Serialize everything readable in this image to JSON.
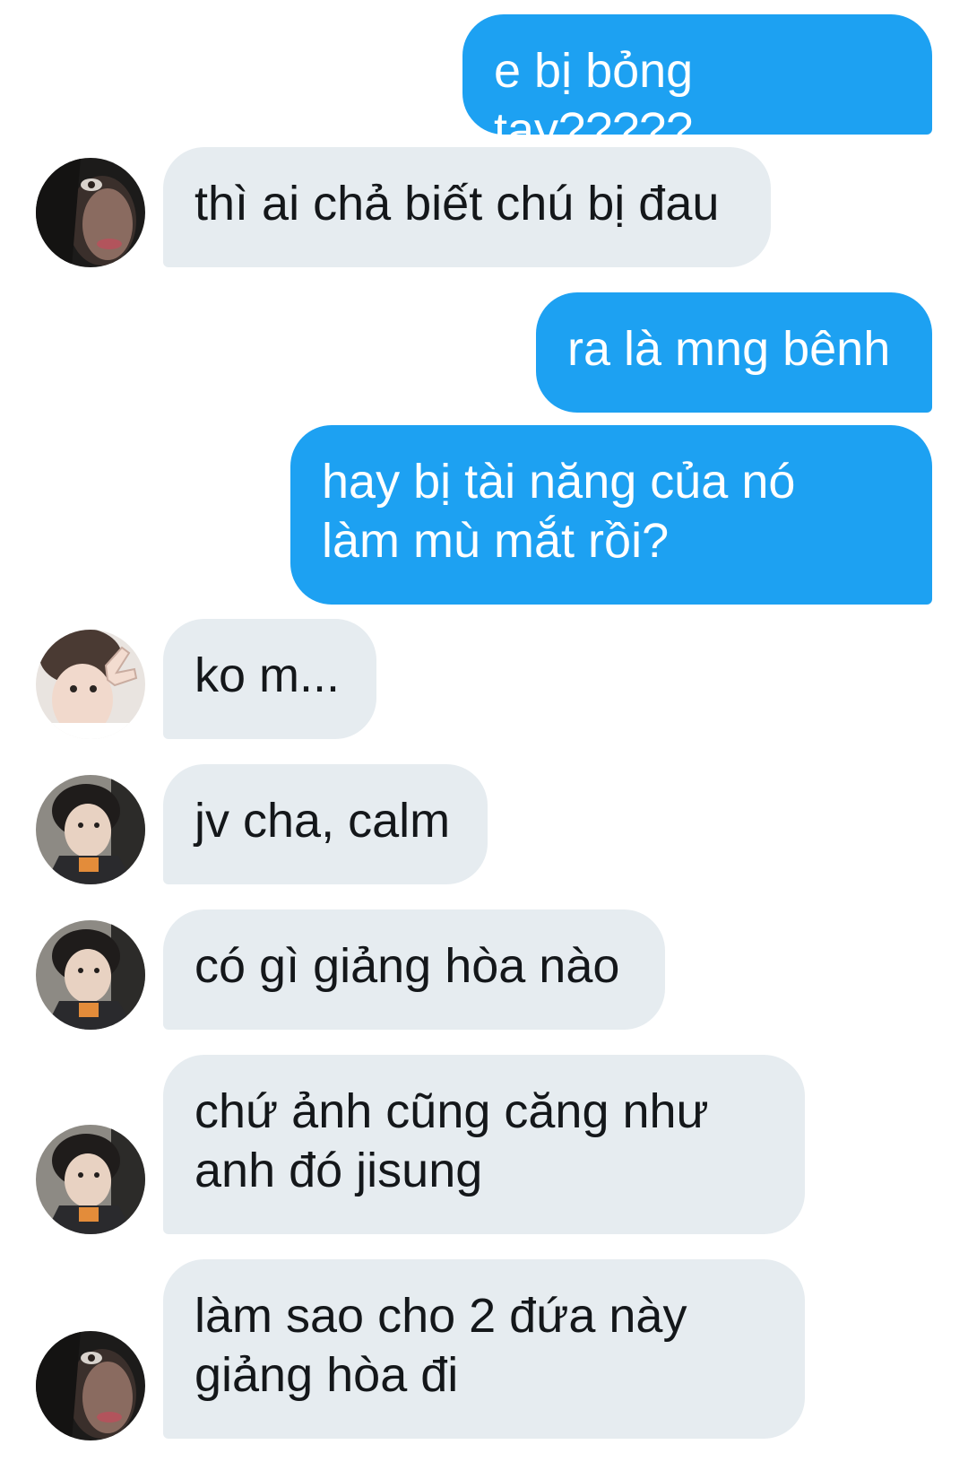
{
  "messages": [
    {
      "side": "out",
      "text": "e bị bỏng tay?????"
    },
    {
      "side": "in",
      "avatar": "dark-hood-avatar-icon",
      "text": "thì ai chả biết chú bị đau"
    },
    {
      "side": "out",
      "text": "ra là mng bênh"
    },
    {
      "side": "out",
      "text": "hay bị tài năng của nó\nlàm mù mắt rồi?"
    },
    {
      "side": "in",
      "avatar": "peace-sign-avatar-icon",
      "text": "ko m..."
    },
    {
      "side": "in",
      "avatar": "dark-hair-avatar-icon",
      "text": "jv cha, calm"
    },
    {
      "side": "in",
      "avatar": "dark-hair-avatar-icon",
      "text": "có gì giảng hòa nào"
    },
    {
      "side": "in",
      "avatar": "dark-hair-avatar-icon",
      "text": "chứ ảnh cũng căng như\nanh đó jisung"
    },
    {
      "side": "in",
      "avatar": "dark-hood-avatar-icon",
      "text": "làm sao cho 2 đứa này\ngiảng hòa đi"
    }
  ],
  "colors": {
    "outgoing_bubble": "#1da1f2",
    "incoming_bubble": "#e6ecf0",
    "outgoing_text": "#ffffff",
    "incoming_text": "#14171a",
    "background": "#ffffff"
  }
}
